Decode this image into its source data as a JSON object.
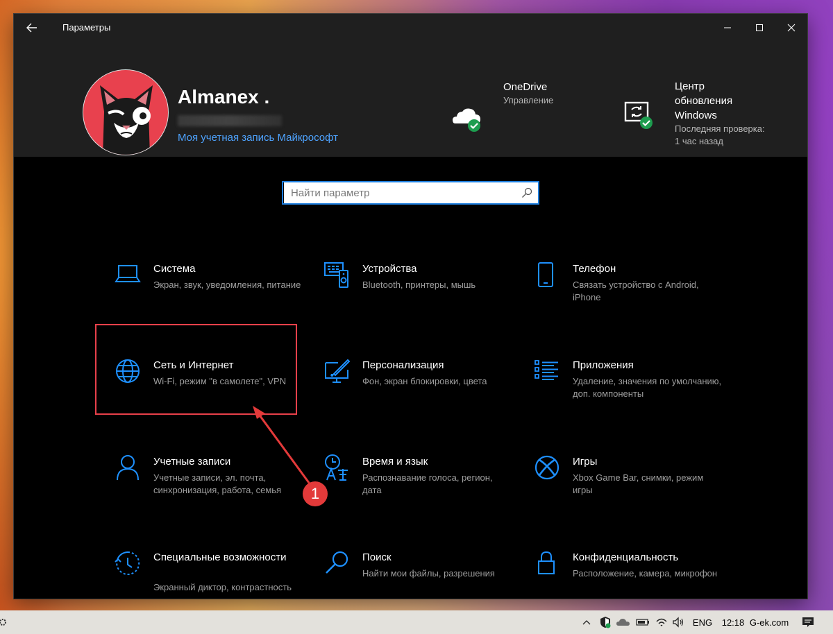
{
  "window": {
    "title": "Параметры"
  },
  "account": {
    "name": "Almanex .",
    "link": "Моя учетная запись Майкрософт"
  },
  "onedrive": {
    "title": "OneDrive",
    "subtitle": "Управление"
  },
  "update": {
    "title_lines": [
      "Центр",
      "обновления",
      "Windows"
    ],
    "sub_lines": [
      "Последняя проверка:",
      "1 час назад"
    ]
  },
  "search": {
    "placeholder": "Найти параметр"
  },
  "tiles": [
    {
      "title": "Система",
      "desc": "Экран, звук, уведомления, питание",
      "icon": "laptop-icon"
    },
    {
      "title": "Устройства",
      "desc": "Bluetooth, принтеры, мышь",
      "icon": "devices-icon"
    },
    {
      "title": "Телефон",
      "desc": "Связать устройство с Android, iPhone",
      "icon": "phone-icon"
    },
    {
      "title": "Сеть и Интернет",
      "desc": "Wi-Fi, режим \"в самолете\", VPN",
      "icon": "globe-icon"
    },
    {
      "title": "Персонализация",
      "desc": "Фон, экран блокировки, цвета",
      "icon": "personalization-icon"
    },
    {
      "title": "Приложения",
      "desc": "Удаление, значения по умолчанию, доп. компоненты",
      "icon": "apps-list-icon"
    },
    {
      "title": "Учетные записи",
      "desc": "Учетные записи, эл. почта, синхронизация, работа, семья",
      "icon": "person-icon"
    },
    {
      "title": "Время и язык",
      "desc": "Распознавание голоса, регион, дата",
      "icon": "time-language-icon"
    },
    {
      "title": "Игры",
      "desc": "Xbox Game Bar, снимки, режим игры",
      "icon": "xbox-icon"
    },
    {
      "title": "Специальные возможности",
      "desc": "Экранный диктор, контрастность",
      "icon": "accessibility-icon"
    },
    {
      "title": "Поиск",
      "desc": "Найти мои файлы, разрешения",
      "icon": "search-magnifier-icon"
    },
    {
      "title": "Конфиденциальность",
      "desc": "Расположение, камера, микрофон",
      "icon": "lock-icon"
    }
  ],
  "annotation": {
    "number": "1"
  },
  "taskbar": {
    "language": "ENG",
    "time": "12:18",
    "site": "G-ek.com"
  },
  "colors": {
    "accent": "#1e90ff",
    "highlight": "#e8404a",
    "window_bg": "#000000",
    "header_bg": "#1f1f1f"
  }
}
